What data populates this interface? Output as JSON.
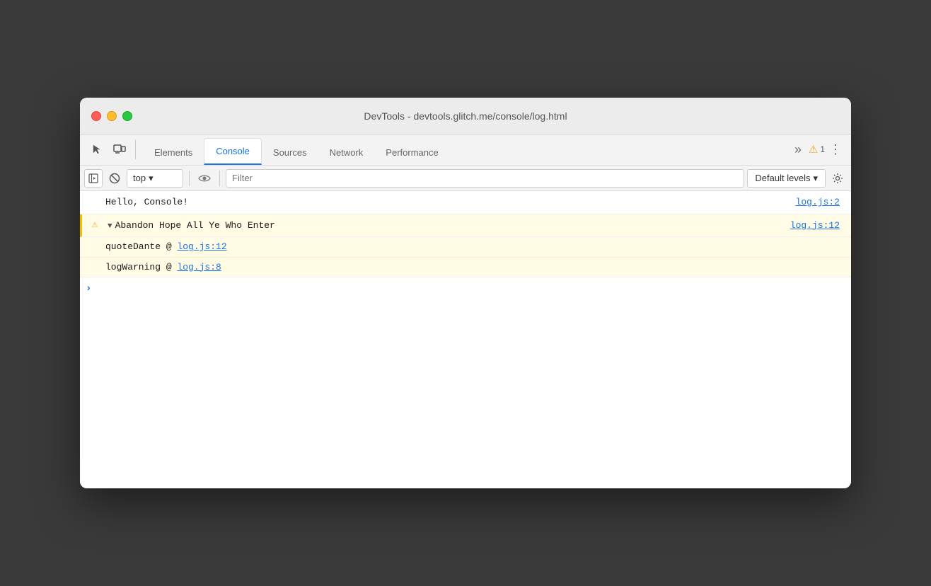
{
  "window": {
    "title": "DevTools - devtools.glitch.me/console/log.html"
  },
  "tabs": {
    "items": [
      {
        "label": "Elements",
        "active": false
      },
      {
        "label": "Console",
        "active": true
      },
      {
        "label": "Sources",
        "active": false
      },
      {
        "label": "Network",
        "active": false
      },
      {
        "label": "Performance",
        "active": false
      }
    ],
    "more_label": "»",
    "warning_count": "1",
    "kebab_label": "⋮"
  },
  "console_toolbar": {
    "context_value": "top",
    "context_arrow": "▾",
    "filter_placeholder": "Filter",
    "levels_label": "Default levels",
    "levels_arrow": "▾"
  },
  "console_rows": [
    {
      "type": "info",
      "text": "Hello, Console!",
      "file_ref": "log.js:2"
    },
    {
      "type": "warning",
      "expanded": true,
      "text": "Abandon Hope All Ye Who Enter",
      "file_ref": "log.js:12"
    },
    {
      "type": "warning-sub",
      "text": "quoteDante @ ",
      "link": "log.js:12"
    },
    {
      "type": "warning-sub",
      "text": "logWarning @ ",
      "link": "log.js:8"
    }
  ],
  "icons": {
    "cursor": "↖",
    "layers": "⧉",
    "context": "▶",
    "clear": "🚫",
    "eye": "👁",
    "gear": "⚙",
    "warning": "⚠"
  }
}
